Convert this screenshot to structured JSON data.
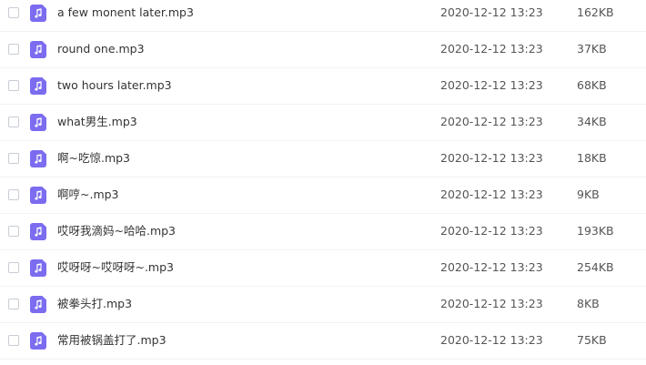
{
  "file_icon_color": "#7b6cf0",
  "file_icon": "music-note-icon",
  "files": [
    {
      "name": "a few monent later.mp3",
      "date": "2020-12-12 13:23",
      "size": "162KB"
    },
    {
      "name": "round one.mp3",
      "date": "2020-12-12 13:23",
      "size": "37KB"
    },
    {
      "name": "two hours later.mp3",
      "date": "2020-12-12 13:23",
      "size": "68KB"
    },
    {
      "name": "what男生.mp3",
      "date": "2020-12-12 13:23",
      "size": "34KB"
    },
    {
      "name": "啊~吃惊.mp3",
      "date": "2020-12-12 13:23",
      "size": "18KB"
    },
    {
      "name": "啊哼~.mp3",
      "date": "2020-12-12 13:23",
      "size": "9KB"
    },
    {
      "name": "哎呀我滴妈~哈哈.mp3",
      "date": "2020-12-12 13:23",
      "size": "193KB"
    },
    {
      "name": "哎呀呀~哎呀呀~.mp3",
      "date": "2020-12-12 13:23",
      "size": "254KB"
    },
    {
      "name": "被拳头打.mp3",
      "date": "2020-12-12 13:23",
      "size": "8KB"
    },
    {
      "name": "常用被锅盖打了.mp3",
      "date": "2020-12-12 13:23",
      "size": "75KB"
    }
  ]
}
